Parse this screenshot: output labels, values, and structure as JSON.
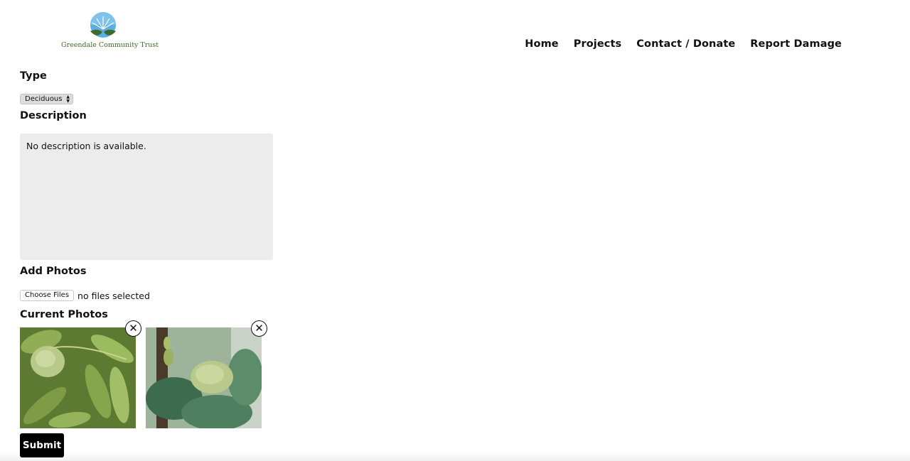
{
  "header": {
    "logo_text": "Greendale Community Trust",
    "nav": [
      "Home",
      "Projects",
      "Contact / Donate",
      "Report Damage"
    ]
  },
  "form": {
    "type_label": "Type",
    "type_value": "Deciduous",
    "description_label": "Description",
    "description_value": "No description is available.",
    "add_photos_label": "Add Photos",
    "choose_files_label": "Choose Files",
    "file_status": "no files selected",
    "current_photos_label": "Current Photos",
    "photos": [
      {
        "name": "walnut-leaves-photo",
        "icon": "close-circle-icon"
      },
      {
        "name": "fir-cone-photo",
        "icon": "close-circle-icon"
      }
    ],
    "submit_label": "Submit"
  },
  "colors": {
    "accent": "#000000",
    "logo_green": "#3f6b2a",
    "logo_blue": "#4aa3df",
    "field_bg": "#ececec"
  }
}
